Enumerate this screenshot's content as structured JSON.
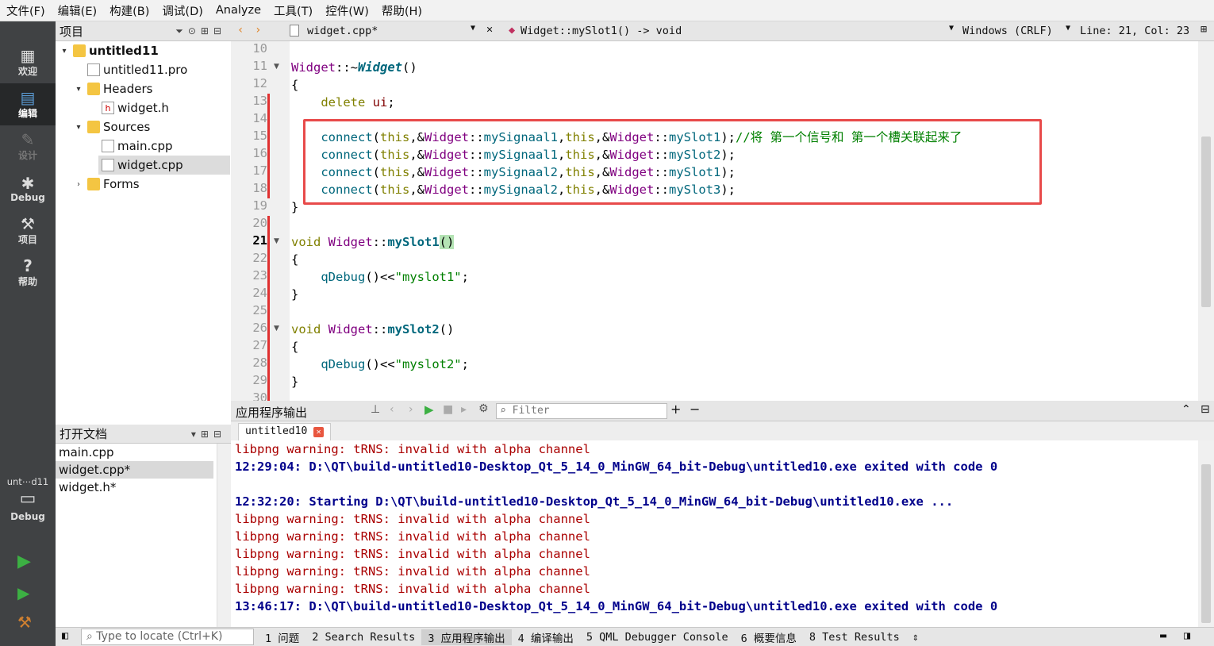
{
  "menu": [
    "文件(F)",
    "编辑(E)",
    "构建(B)",
    "调试(D)",
    "Analyze",
    "工具(T)",
    "控件(W)",
    "帮助(H)"
  ],
  "modes": [
    {
      "label": "欢迎",
      "icon": "grid-icon"
    },
    {
      "label": "编辑",
      "icon": "edit-icon"
    },
    {
      "label": "设计",
      "icon": "pencil-icon"
    },
    {
      "label": "Debug",
      "icon": "bug-icon"
    },
    {
      "label": "项目",
      "icon": "wrench-icon"
    },
    {
      "label": "帮助",
      "icon": "help-icon"
    }
  ],
  "kit": {
    "project": "unt⋯d11",
    "mode": "Debug"
  },
  "project_panel": {
    "title": "项目",
    "tree": [
      {
        "label": "untitled11",
        "level": 0,
        "arrow": "▾",
        "bold": true
      },
      {
        "label": "untitled11.pro",
        "level": 1,
        "arrow": ""
      },
      {
        "label": "Headers",
        "level": 1,
        "arrow": "▾"
      },
      {
        "label": "widget.h",
        "level": 2,
        "arrow": ""
      },
      {
        "label": "Sources",
        "level": 1,
        "arrow": "▾"
      },
      {
        "label": "main.cpp",
        "level": 2,
        "arrow": ""
      },
      {
        "label": "widget.cpp",
        "level": 2,
        "arrow": ""
      },
      {
        "label": "Forms",
        "level": 1,
        "arrow": "›"
      }
    ]
  },
  "open_docs": {
    "title": "打开文档",
    "items": [
      "main.cpp",
      "widget.cpp*",
      "widget.h*"
    ]
  },
  "editor": {
    "file_tab": "widget.cpp*",
    "symbol": "Widget::mySlot1() -> void",
    "line_ending": "Windows (CRLF)",
    "position": "Line: 21, Col: 23",
    "line_numbers": [
      "10",
      "11",
      "12",
      "13",
      "14",
      "15",
      "16",
      "17",
      "18",
      "19",
      "20",
      "21",
      "22",
      "23",
      "24",
      "25",
      "26",
      "27",
      "28",
      "29",
      "30"
    ],
    "current_line": "21"
  },
  "output_panel": {
    "title": "应用程序输出",
    "filter_placeholder": "Filter",
    "tab": "untitled10",
    "lines": [
      {
        "text": "libpng warning: tRNS: invalid with alpha channel",
        "kind": "warn"
      },
      {
        "text": "12:29:04: D:\\QT\\build-untitled10-Desktop_Qt_5_14_0_MinGW_64_bit-Debug\\untitled10.exe exited with code 0",
        "kind": "info"
      },
      {
        "text": "",
        "kind": "warn"
      },
      {
        "text": "12:32:20: Starting D:\\QT\\build-untitled10-Desktop_Qt_5_14_0_MinGW_64_bit-Debug\\untitled10.exe ...",
        "kind": "info"
      },
      {
        "text": "libpng warning: tRNS: invalid with alpha channel",
        "kind": "warn"
      },
      {
        "text": "libpng warning: tRNS: invalid with alpha channel",
        "kind": "warn"
      },
      {
        "text": "libpng warning: tRNS: invalid with alpha channel",
        "kind": "warn"
      },
      {
        "text": "libpng warning: tRNS: invalid with alpha channel",
        "kind": "warn"
      },
      {
        "text": "libpng warning: tRNS: invalid with alpha channel",
        "kind": "warn"
      },
      {
        "text": "13:46:17: D:\\QT\\build-untitled10-Desktop_Qt_5_14_0_MinGW_64_bit-Debug\\untitled10.exe exited with code 0",
        "kind": "info"
      }
    ]
  },
  "statusbar": {
    "locate_placeholder": "Type to locate (Ctrl+K)",
    "panes": [
      "1 问题",
      "2 Search Results",
      "3 应用程序输出",
      "4 编译输出",
      "5 QML Debugger Console",
      "6 概要信息",
      "8 Test Results"
    ]
  },
  "colors": {
    "highlight_box": "#e84a4a",
    "change_marker": "#e03030",
    "warning_text": "#aa0000",
    "info_text": "#00008b"
  }
}
